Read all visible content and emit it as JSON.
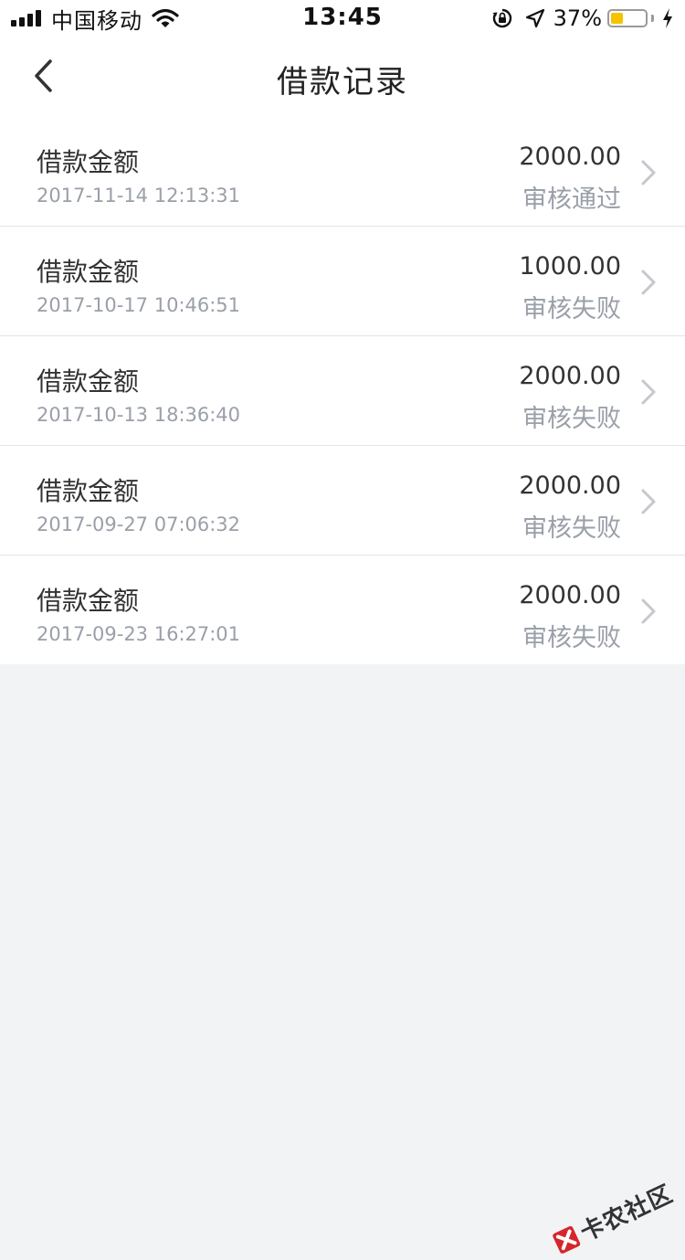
{
  "status_bar": {
    "carrier": "中国移动",
    "time": "13:45",
    "battery_percent_text": "37%",
    "battery_level": 0.37,
    "signal_icon": "signal-bars-icon",
    "wifi_icon": "wifi-icon",
    "orientation_lock_icon": "orientation-lock-icon",
    "location_icon": "location-arrow-icon",
    "charging_icon": "charging-bolt-icon"
  },
  "nav": {
    "title": "借款记录",
    "back_icon": "chevron-left-icon"
  },
  "records": [
    {
      "label": "借款金额",
      "datetime": "2017-11-14 12:13:31",
      "amount": "2000.00",
      "status": "审核通过"
    },
    {
      "label": "借款金额",
      "datetime": "2017-10-17 10:46:51",
      "amount": "1000.00",
      "status": "审核失败"
    },
    {
      "label": "借款金额",
      "datetime": "2017-10-13 18:36:40",
      "amount": "2000.00",
      "status": "审核失败"
    },
    {
      "label": "借款金额",
      "datetime": "2017-09-27 07:06:32",
      "amount": "2000.00",
      "status": "审核失败"
    },
    {
      "label": "借款金额",
      "datetime": "2017-09-23 16:27:01",
      "amount": "2000.00",
      "status": "审核失败"
    }
  ],
  "watermark": {
    "text": "卡农社区",
    "logo_icon": "kanong-logo-icon"
  },
  "colors": {
    "background": "#f2f3f5",
    "card": "#ffffff",
    "primary_text": "#333333",
    "secondary_text": "#9a9fa8",
    "divider": "#e4e4e4",
    "battery_fill": "#f6c300",
    "chevron": "#c7c7cc"
  }
}
